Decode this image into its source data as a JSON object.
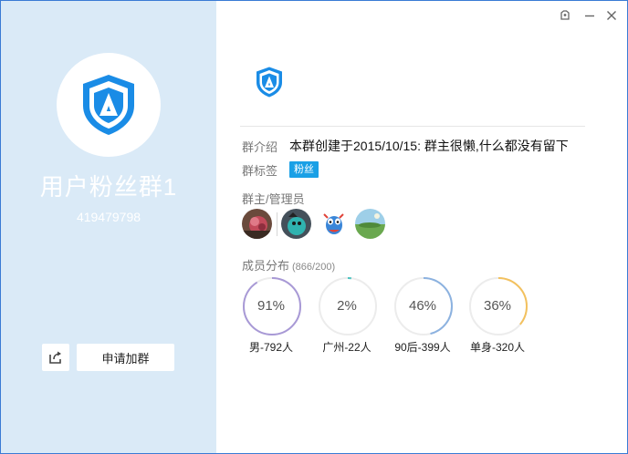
{
  "group": {
    "name": "用户粉丝群1",
    "id": "419479798"
  },
  "actions": {
    "share_icon": "share-icon",
    "join_label": "申请加群"
  },
  "window_controls": {
    "skin_icon": "skin-icon",
    "minimize_icon": "minimize-icon",
    "close_icon": "close-icon"
  },
  "info": {
    "intro_label": "群介绍",
    "intro_text": "本群创建于2015/10/15:  群主很懒,什么都没有留下",
    "tags_label": "群标签",
    "tags": [
      "粉丝"
    ],
    "admins_label": "群主/管理员"
  },
  "distribution": {
    "label": "成员分布",
    "count": "(866/200)",
    "stats": [
      {
        "percent_text": "91%",
        "label": "男-792人",
        "value": 0.91,
        "color": "#a899d6"
      },
      {
        "percent_text": "2%",
        "label": "广州-22人",
        "value": 0.02,
        "color": "#4cc3c0"
      },
      {
        "percent_text": "46%",
        "label": "90后-399人",
        "value": 0.46,
        "color": "#8cb2e0"
      },
      {
        "percent_text": "36%",
        "label": "单身-320人",
        "value": 0.36,
        "color": "#f3c15e"
      }
    ]
  },
  "colors": {
    "brand_blue": "#1a8ce6",
    "left_panel_bg": "#daeaf7",
    "tag_blue": "#1aa0e6"
  }
}
